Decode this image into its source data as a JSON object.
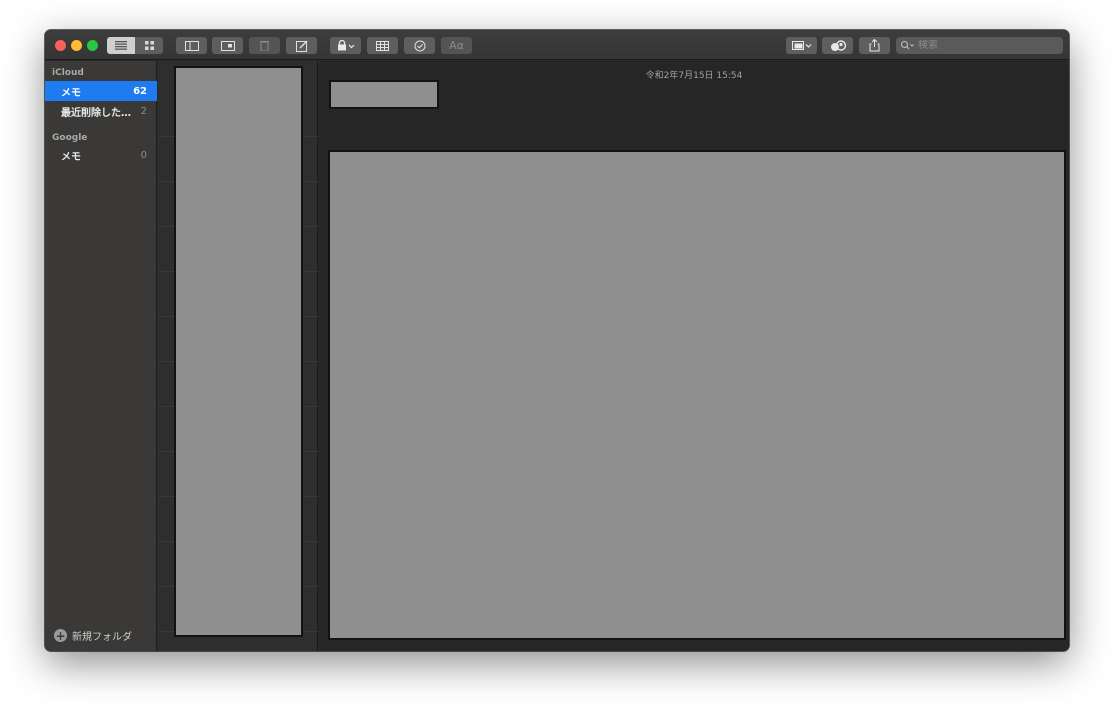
{
  "window": {
    "toolbar": {
      "view_list_label": "",
      "view_gallery_label": "",
      "font_button_label": "Aα",
      "search_placeholder": "検索"
    },
    "sidebar": {
      "sections": [
        {
          "title": "iCloud",
          "folders": [
            {
              "label": "メモ",
              "count": "62",
              "selected": true
            },
            {
              "label": "最近削除した…",
              "count": "2",
              "selected": false
            }
          ]
        },
        {
          "title": "Google",
          "folders": [
            {
              "label": "メモ",
              "count": "0",
              "selected": false
            }
          ]
        }
      ],
      "new_folder_label": "新規フォルダ"
    },
    "editor": {
      "date": "令和2年7月15日 15:54"
    }
  },
  "colors": {
    "accent": "#1e7bf0",
    "close": "#fe5f57",
    "minimize": "#febc2e",
    "maximize": "#28c840",
    "redaction": "#8f8f8f"
  }
}
